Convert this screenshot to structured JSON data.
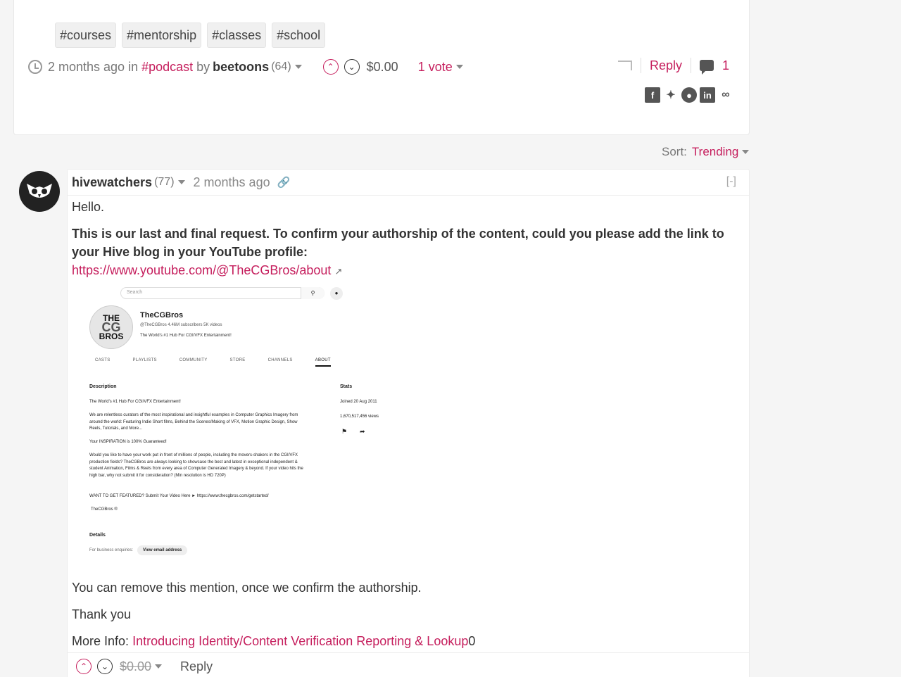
{
  "post": {
    "tags": [
      "#courses",
      "#mentorship",
      "#classes",
      "#school"
    ],
    "time": "2 months ago",
    "in_text": "in",
    "community": "#podcast",
    "by_text": "by",
    "author": "beetoons",
    "reputation": "(64)",
    "payout": "$0.00",
    "votes": "1 vote",
    "reply_label": "Reply",
    "comment_count": "1"
  },
  "sort": {
    "label": "Sort:",
    "value": "Trending"
  },
  "comment": {
    "author": "hivewatchers",
    "reputation": "(77)",
    "time": "2 months ago",
    "collapse": "[-]",
    "greeting": "Hello.",
    "request": "This is our last and final request. To confirm your authorship of the content, could you please add the link to your Hive blog in your YouTube profile:",
    "link": "https://www.youtube.com/@TheCGBros/about",
    "remove_note": "You can remove this mention, once we confirm the authorship.",
    "thanks": "Thank you",
    "more_info_label": "More Info:",
    "more_info_link": "Introducing Identity/Content Verification Reporting & Lookup",
    "more_info_suffix": "0",
    "payout": "$0.00",
    "reply_label": "Reply"
  },
  "embedded": {
    "search_placeholder": "Search",
    "channel_name": "TheCGBros",
    "handle_line": "@TheCGBros  4.46M subscribers  5K videos",
    "tagline": "The World's #1 Hub For CGI/VFX Entertainment!",
    "logo_the": "THE",
    "logo_cg": "CG",
    "logo_bros": "BROS",
    "tabs": [
      "CASTS",
      "PLAYLISTS",
      "COMMUNITY",
      "STORE",
      "CHANNELS",
      "ABOUT"
    ],
    "description_heading": "Description",
    "desc_1": "The World's #1 Hub For CGI/VFX Entertainment!",
    "desc_2": "We are relentless curators of the most inspirational and insightful examples in Computer Graphics Imagery from around the world: Featuring Indie Short films, Behind the Scenes/Making of VFX, Motion Graphic Design, Show Reels, Tutorials, and More...",
    "desc_3": "Your INSPIRATION is 100% Guaranteed!",
    "desc_4": "Would you like to have your work put in front of millions of people, including the movers-shakers in the CGI/VFX production fields?   TheCGBros are always looking to showcase the best and latest in exceptional independent & student  Animation, Films & Reels from every area of Computer Generated Imagery & beyond. If your video hits the high bar, why not submit it for consideration?  (Min resolution is HD 720P)",
    "desc_5": "WANT TO GET FEATURED? Submit Your Video Here  ► https://www.thecgbros.com/getstarted/",
    "desc_6": "TheCGBros ®",
    "stats_heading": "Stats",
    "joined": "Joined 20 Aug 2011",
    "views": "1,670,517,456 views",
    "details_heading": "Details",
    "business_label": "For business enquiries:",
    "email_button": "View email address"
  },
  "colors": {
    "accent": "#c51d5c",
    "text": "#333333",
    "muted": "#777777",
    "background": "#f5f5f5"
  },
  "icons": [
    "clock-icon",
    "upvote-icon",
    "downvote-icon",
    "reblog-icon",
    "comment-icon",
    "facebook-icon",
    "twitter-icon",
    "reddit-icon",
    "linkedin-icon",
    "link-icon",
    "owl-avatar",
    "external-link-icon"
  ]
}
